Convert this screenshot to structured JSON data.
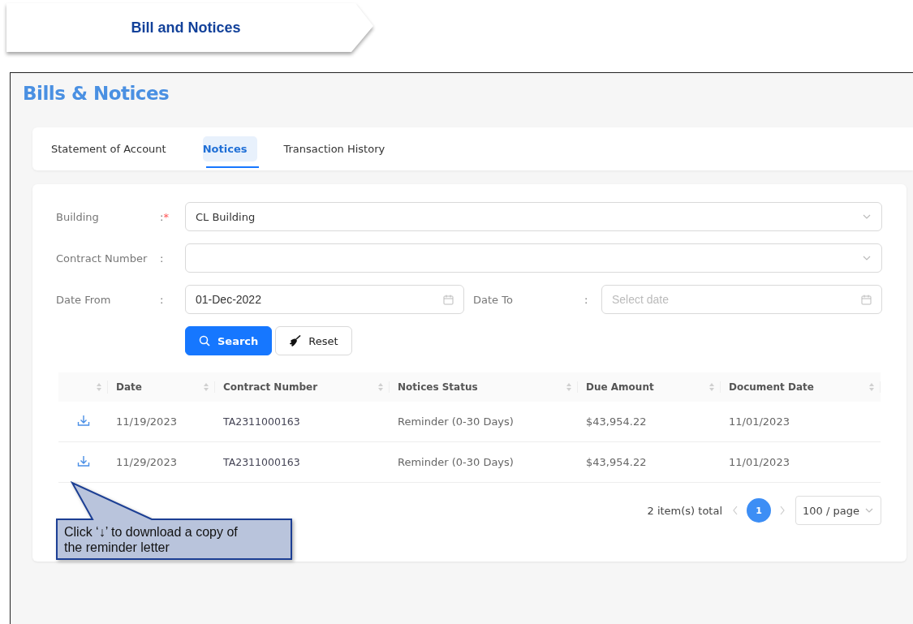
{
  "banner": {
    "title": "Bill and Notices"
  },
  "page": {
    "title": "Bills & Notices"
  },
  "tabs": [
    {
      "label": "Statement of Account",
      "selected": false
    },
    {
      "label": "Notices",
      "selected": true
    },
    {
      "label": "Transaction History",
      "selected": false
    }
  ],
  "form": {
    "rows": [
      [
        {
          "label": "Building",
          "separator": ":",
          "required_mark": "*",
          "kind": "select",
          "value": "CL Building"
        }
      ],
      [
        {
          "label": "Contract Number",
          "separator": ":",
          "kind": "select"
        }
      ],
      [
        {
          "label": "Date From",
          "separator": ":",
          "kind": "date",
          "value": "01-Dec-2022"
        },
        {
          "label": "Date To",
          "separator": ":",
          "kind": "date",
          "placeholder": "Select date"
        }
      ]
    ],
    "buttons": [
      {
        "label": "Search",
        "kind": "primary"
      },
      {
        "label": "Reset",
        "kind": "default"
      }
    ]
  },
  "table": {
    "columns": [
      "Date",
      "Contract Number",
      "Notices Status",
      "Due Amount",
      "Document Date"
    ],
    "rows": [
      [
        "11/19/2023",
        "TA2311000163",
        "Reminder (0-30 Days)",
        "$43,954.22",
        "11/01/2023"
      ],
      [
        "11/29/2023",
        "TA2311000163",
        "Reminder (0-30 Days)",
        "$43,954.22",
        "11/01/2023"
      ]
    ]
  },
  "pagination": {
    "total": "2 item(s) total",
    "pages": [
      {
        "label": "1",
        "selected": true
      }
    ],
    "page_size": "100 / page"
  },
  "callout": {
    "text": "Click ‘↓’ to download a copy of the reminder letter"
  }
}
